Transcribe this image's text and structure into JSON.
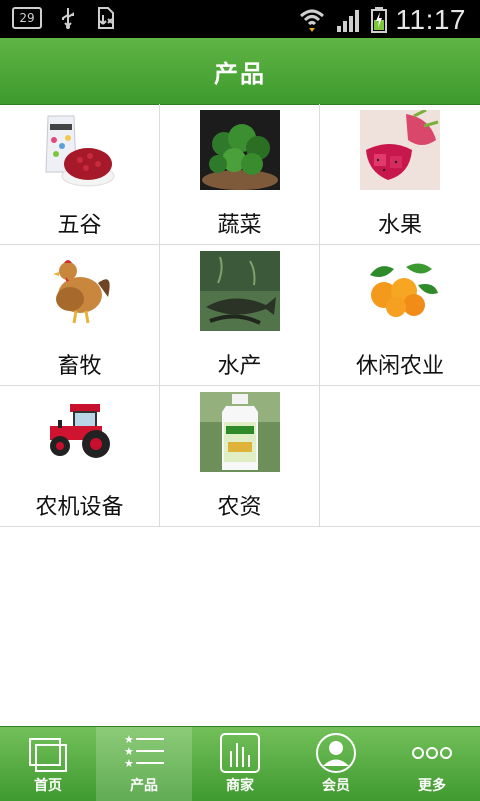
{
  "status_bar": {
    "badge": "29",
    "time": "11:17"
  },
  "header": {
    "title": "产品"
  },
  "categories": [
    {
      "label": "五谷",
      "icon": "grain-bag-image"
    },
    {
      "label": "蔬菜",
      "icon": "vegetable-image"
    },
    {
      "label": "水果",
      "icon": "dragon-fruit-image"
    },
    {
      "label": "畜牧",
      "icon": "chicken-image"
    },
    {
      "label": "水产",
      "icon": "fish-image"
    },
    {
      "label": "休闲农业",
      "icon": "orange-image"
    },
    {
      "label": "农机设备",
      "icon": "tractor-image"
    },
    {
      "label": "农资",
      "icon": "fertilizer-bottle-image"
    }
  ],
  "bottom_nav": [
    {
      "label": "首页",
      "icon": "home-windows-icon"
    },
    {
      "label": "产品",
      "icon": "list-stars-icon",
      "active": true
    },
    {
      "label": "商家",
      "icon": "bar-chart-icon"
    },
    {
      "label": "会员",
      "icon": "member-avatar-icon"
    },
    {
      "label": "更多",
      "icon": "more-dots-icon"
    }
  ],
  "colors": {
    "accent_green": "#4aa63a",
    "border_gray": "#dcdcdc"
  }
}
